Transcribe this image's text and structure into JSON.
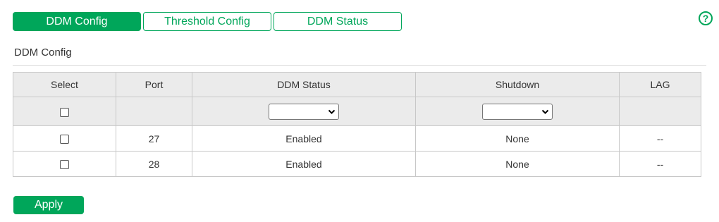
{
  "tabs": [
    {
      "label": "DDM Config",
      "active": true
    },
    {
      "label": "Threshold Config",
      "active": false
    },
    {
      "label": "DDM Status",
      "active": false
    }
  ],
  "help": {
    "icon": "help-icon",
    "glyph": "?"
  },
  "section": {
    "title": "DDM Config"
  },
  "table": {
    "headers": [
      "Select",
      "Port",
      "DDM Status",
      "Shutdown",
      "LAG"
    ],
    "filter": {
      "ddm_status_value": "",
      "shutdown_value": ""
    },
    "rows": [
      {
        "selected": false,
        "port": "27",
        "ddm_status": "Enabled",
        "shutdown": "None",
        "lag": "--"
      },
      {
        "selected": false,
        "port": "28",
        "ddm_status": "Enabled",
        "shutdown": "None",
        "lag": "--"
      }
    ]
  },
  "actions": {
    "apply_label": "Apply"
  },
  "colors": {
    "accent": "#00a65a",
    "header_bg": "#ebebeb",
    "border": "#c8c8c8"
  }
}
